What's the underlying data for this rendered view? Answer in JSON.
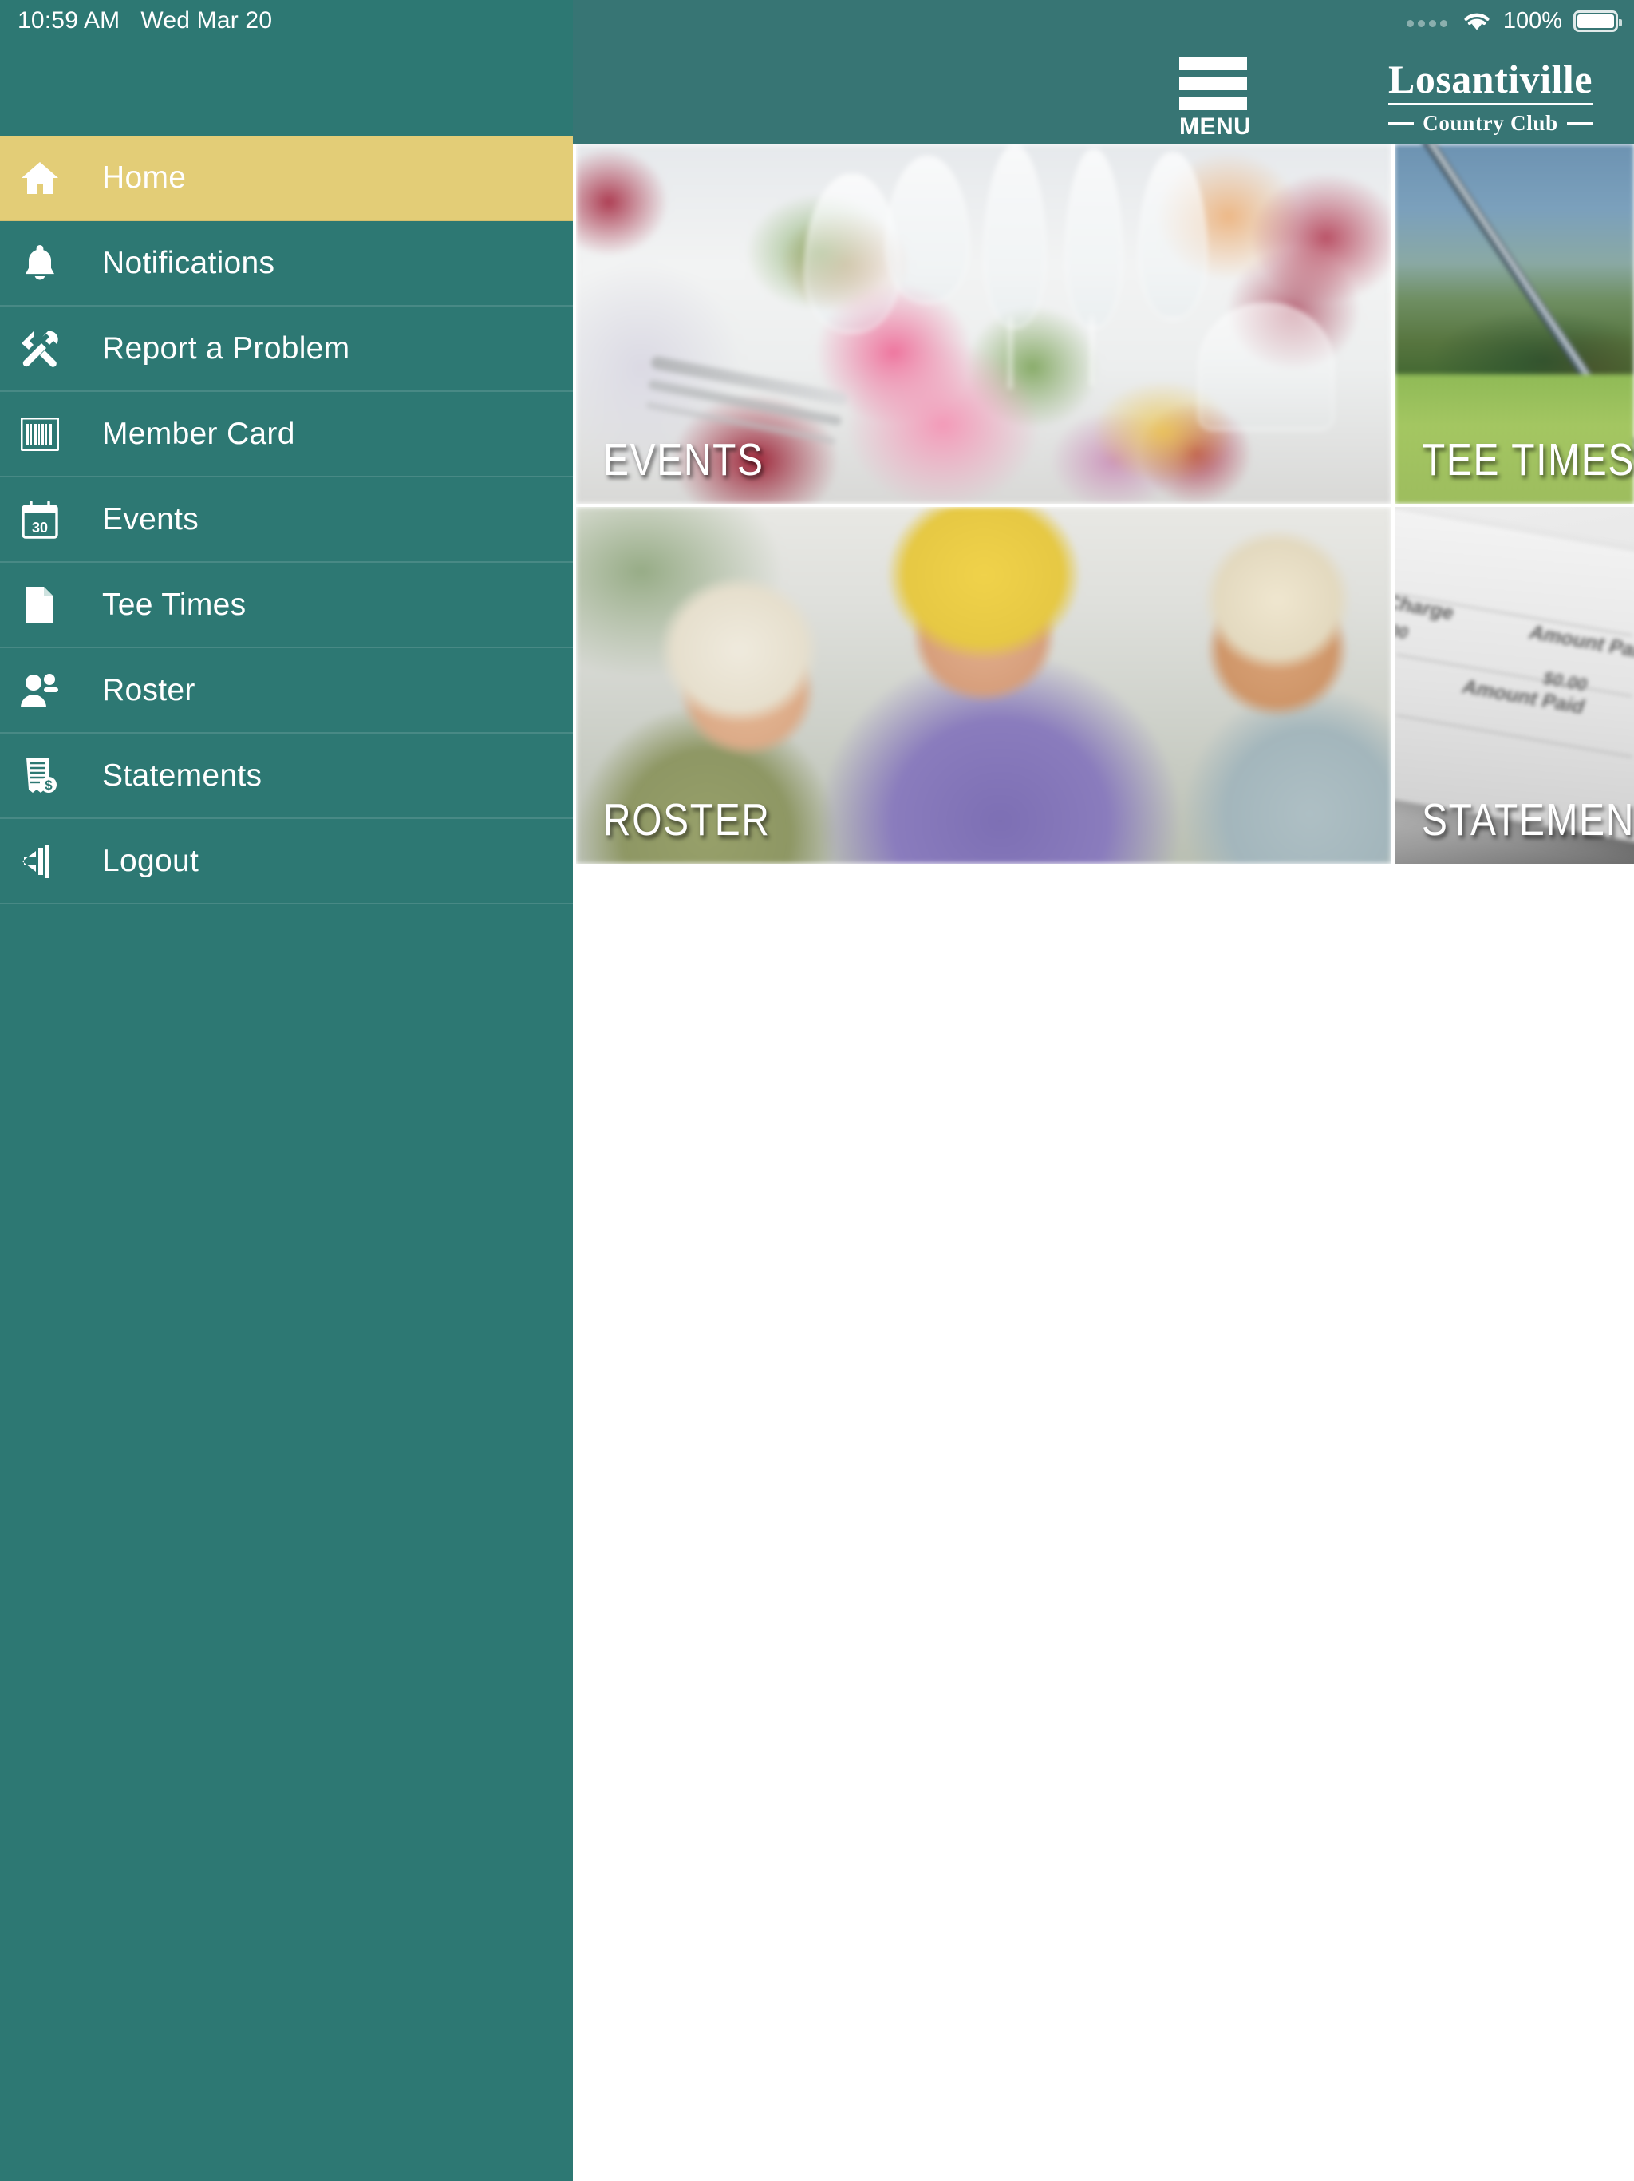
{
  "status_bar": {
    "time": "10:59 AM",
    "date": "Wed Mar 20",
    "battery_percent": "100%",
    "wifi_icon": "wifi-icon",
    "signal_icon": "signal-dots-icon",
    "battery_icon": "battery-full-icon"
  },
  "header": {
    "menu_label": "MENU",
    "menu_icon": "hamburger-menu-icon",
    "brand_name": "Losantiville",
    "brand_subtitle": "Country Club"
  },
  "sidebar": {
    "items": [
      {
        "label": "Home",
        "icon": "home-icon",
        "active": true
      },
      {
        "label": "Notifications",
        "icon": "bell-icon",
        "active": false
      },
      {
        "label": "Report a Problem",
        "icon": "tools-icon",
        "active": false
      },
      {
        "label": "Member Card",
        "icon": "barcode-icon",
        "active": false
      },
      {
        "label": "Events",
        "icon": "calendar-icon",
        "active": false
      },
      {
        "label": "Tee Times",
        "icon": "document-icon",
        "active": false
      },
      {
        "label": "Roster",
        "icon": "user-plus-icon",
        "active": false
      },
      {
        "label": "Statements",
        "icon": "invoice-icon",
        "active": false
      },
      {
        "label": "Logout",
        "icon": "logout-icon",
        "active": false
      }
    ]
  },
  "tiles": [
    {
      "label": "EVENTS",
      "image": "banquet-table-flowers-photo"
    },
    {
      "label": "TEE TIMES",
      "image": "golf-club-green-photo"
    },
    {
      "label": "ROSTER",
      "image": "smiling-golfers-group-photo"
    },
    {
      "label": "STATEMENTS",
      "image": "invoice-statement-photo"
    }
  ],
  "statement_image_text": {
    "charge": "Charge",
    "amount_paid_1": "Amount Paid",
    "amount_paid_2": "Amount Paid",
    "value_1": "$0.00",
    "value_2": "$0.00"
  },
  "colors": {
    "sidebar_teal": "#2d7873",
    "header_teal": "#377574",
    "active_gold": "#e3cd77",
    "text_white": "#ffffff",
    "content_bg": "#ffffff"
  }
}
